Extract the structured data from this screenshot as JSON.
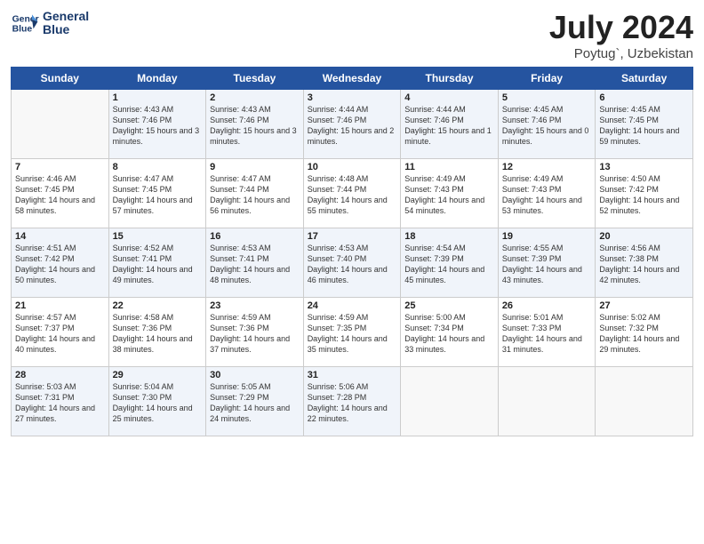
{
  "logo": {
    "line1": "General",
    "line2": "Blue"
  },
  "title": "July 2024",
  "location": "Poytug`, Uzbekistan",
  "days_of_week": [
    "Sunday",
    "Monday",
    "Tuesday",
    "Wednesday",
    "Thursday",
    "Friday",
    "Saturday"
  ],
  "weeks": [
    [
      {
        "day": "",
        "sunrise": "",
        "sunset": "",
        "daylight": ""
      },
      {
        "day": "1",
        "sunrise": "Sunrise: 4:43 AM",
        "sunset": "Sunset: 7:46 PM",
        "daylight": "Daylight: 15 hours and 3 minutes."
      },
      {
        "day": "2",
        "sunrise": "Sunrise: 4:43 AM",
        "sunset": "Sunset: 7:46 PM",
        "daylight": "Daylight: 15 hours and 3 minutes."
      },
      {
        "day": "3",
        "sunrise": "Sunrise: 4:44 AM",
        "sunset": "Sunset: 7:46 PM",
        "daylight": "Daylight: 15 hours and 2 minutes."
      },
      {
        "day": "4",
        "sunrise": "Sunrise: 4:44 AM",
        "sunset": "Sunset: 7:46 PM",
        "daylight": "Daylight: 15 hours and 1 minute."
      },
      {
        "day": "5",
        "sunrise": "Sunrise: 4:45 AM",
        "sunset": "Sunset: 7:46 PM",
        "daylight": "Daylight: 15 hours and 0 minutes."
      },
      {
        "day": "6",
        "sunrise": "Sunrise: 4:45 AM",
        "sunset": "Sunset: 7:45 PM",
        "daylight": "Daylight: 14 hours and 59 minutes."
      }
    ],
    [
      {
        "day": "7",
        "sunrise": "Sunrise: 4:46 AM",
        "sunset": "Sunset: 7:45 PM",
        "daylight": "Daylight: 14 hours and 58 minutes."
      },
      {
        "day": "8",
        "sunrise": "Sunrise: 4:47 AM",
        "sunset": "Sunset: 7:45 PM",
        "daylight": "Daylight: 14 hours and 57 minutes."
      },
      {
        "day": "9",
        "sunrise": "Sunrise: 4:47 AM",
        "sunset": "Sunset: 7:44 PM",
        "daylight": "Daylight: 14 hours and 56 minutes."
      },
      {
        "day": "10",
        "sunrise": "Sunrise: 4:48 AM",
        "sunset": "Sunset: 7:44 PM",
        "daylight": "Daylight: 14 hours and 55 minutes."
      },
      {
        "day": "11",
        "sunrise": "Sunrise: 4:49 AM",
        "sunset": "Sunset: 7:43 PM",
        "daylight": "Daylight: 14 hours and 54 minutes."
      },
      {
        "day": "12",
        "sunrise": "Sunrise: 4:49 AM",
        "sunset": "Sunset: 7:43 PM",
        "daylight": "Daylight: 14 hours and 53 minutes."
      },
      {
        "day": "13",
        "sunrise": "Sunrise: 4:50 AM",
        "sunset": "Sunset: 7:42 PM",
        "daylight": "Daylight: 14 hours and 52 minutes."
      }
    ],
    [
      {
        "day": "14",
        "sunrise": "Sunrise: 4:51 AM",
        "sunset": "Sunset: 7:42 PM",
        "daylight": "Daylight: 14 hours and 50 minutes."
      },
      {
        "day": "15",
        "sunrise": "Sunrise: 4:52 AM",
        "sunset": "Sunset: 7:41 PM",
        "daylight": "Daylight: 14 hours and 49 minutes."
      },
      {
        "day": "16",
        "sunrise": "Sunrise: 4:53 AM",
        "sunset": "Sunset: 7:41 PM",
        "daylight": "Daylight: 14 hours and 48 minutes."
      },
      {
        "day": "17",
        "sunrise": "Sunrise: 4:53 AM",
        "sunset": "Sunset: 7:40 PM",
        "daylight": "Daylight: 14 hours and 46 minutes."
      },
      {
        "day": "18",
        "sunrise": "Sunrise: 4:54 AM",
        "sunset": "Sunset: 7:39 PM",
        "daylight": "Daylight: 14 hours and 45 minutes."
      },
      {
        "day": "19",
        "sunrise": "Sunrise: 4:55 AM",
        "sunset": "Sunset: 7:39 PM",
        "daylight": "Daylight: 14 hours and 43 minutes."
      },
      {
        "day": "20",
        "sunrise": "Sunrise: 4:56 AM",
        "sunset": "Sunset: 7:38 PM",
        "daylight": "Daylight: 14 hours and 42 minutes."
      }
    ],
    [
      {
        "day": "21",
        "sunrise": "Sunrise: 4:57 AM",
        "sunset": "Sunset: 7:37 PM",
        "daylight": "Daylight: 14 hours and 40 minutes."
      },
      {
        "day": "22",
        "sunrise": "Sunrise: 4:58 AM",
        "sunset": "Sunset: 7:36 PM",
        "daylight": "Daylight: 14 hours and 38 minutes."
      },
      {
        "day": "23",
        "sunrise": "Sunrise: 4:59 AM",
        "sunset": "Sunset: 7:36 PM",
        "daylight": "Daylight: 14 hours and 37 minutes."
      },
      {
        "day": "24",
        "sunrise": "Sunrise: 4:59 AM",
        "sunset": "Sunset: 7:35 PM",
        "daylight": "Daylight: 14 hours and 35 minutes."
      },
      {
        "day": "25",
        "sunrise": "Sunrise: 5:00 AM",
        "sunset": "Sunset: 7:34 PM",
        "daylight": "Daylight: 14 hours and 33 minutes."
      },
      {
        "day": "26",
        "sunrise": "Sunrise: 5:01 AM",
        "sunset": "Sunset: 7:33 PM",
        "daylight": "Daylight: 14 hours and 31 minutes."
      },
      {
        "day": "27",
        "sunrise": "Sunrise: 5:02 AM",
        "sunset": "Sunset: 7:32 PM",
        "daylight": "Daylight: 14 hours and 29 minutes."
      }
    ],
    [
      {
        "day": "28",
        "sunrise": "Sunrise: 5:03 AM",
        "sunset": "Sunset: 7:31 PM",
        "daylight": "Daylight: 14 hours and 27 minutes."
      },
      {
        "day": "29",
        "sunrise": "Sunrise: 5:04 AM",
        "sunset": "Sunset: 7:30 PM",
        "daylight": "Daylight: 14 hours and 25 minutes."
      },
      {
        "day": "30",
        "sunrise": "Sunrise: 5:05 AM",
        "sunset": "Sunset: 7:29 PM",
        "daylight": "Daylight: 14 hours and 24 minutes."
      },
      {
        "day": "31",
        "sunrise": "Sunrise: 5:06 AM",
        "sunset": "Sunset: 7:28 PM",
        "daylight": "Daylight: 14 hours and 22 minutes."
      },
      {
        "day": "",
        "sunrise": "",
        "sunset": "",
        "daylight": ""
      },
      {
        "day": "",
        "sunrise": "",
        "sunset": "",
        "daylight": ""
      },
      {
        "day": "",
        "sunrise": "",
        "sunset": "",
        "daylight": ""
      }
    ]
  ]
}
